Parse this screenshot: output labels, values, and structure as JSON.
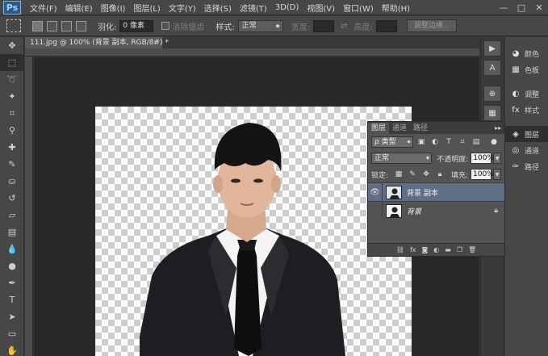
{
  "app": {
    "logo": "Ps"
  },
  "menu": [
    "文件(F)",
    "编辑(E)",
    "图像(I)",
    "图层(L)",
    "文字(Y)",
    "选择(S)",
    "滤镜(T)",
    "3D(D)",
    "视图(V)",
    "窗口(W)",
    "帮助(H)"
  ],
  "window_controls": {
    "minimize": "—",
    "maximize": "□",
    "close": "✕"
  },
  "options_bar": {
    "feather_label": "羽化:",
    "feather_value": "0 像素",
    "antialias_label": "消除锯齿",
    "style_label": "样式:",
    "style_value": "正常",
    "width_label": "宽度:",
    "height_label": "高度:",
    "refine_button": "调整边缘..."
  },
  "document": {
    "tab_title": "111.jpg @ 100% (背景 副本, RGB/8#) *",
    "tab_close": "×"
  },
  "right_panels": [
    "颜色",
    "色板",
    "调整",
    "样式",
    "图层",
    "通道",
    "路径"
  ],
  "layers_panel": {
    "tabs": [
      "图层",
      "通道",
      "路径"
    ],
    "menu_icon": "▸▸",
    "filter_label": "ρ 类型",
    "blend_mode": "正常",
    "opacity_label": "不透明度:",
    "opacity_value": "100%",
    "lock_label": "锁定:",
    "fill_label": "填充:",
    "fill_value": "100%",
    "layers": [
      {
        "name": "背景 副本",
        "visible": true,
        "selected": true,
        "italic": false
      },
      {
        "name": "背景",
        "visible": false,
        "selected": false,
        "italic": true,
        "locked": true
      }
    ],
    "footer_icons": [
      "link-icon",
      "fx-icon",
      "mask-icon",
      "adjustment-icon",
      "group-icon",
      "new-layer-icon",
      "trash-icon"
    ]
  }
}
